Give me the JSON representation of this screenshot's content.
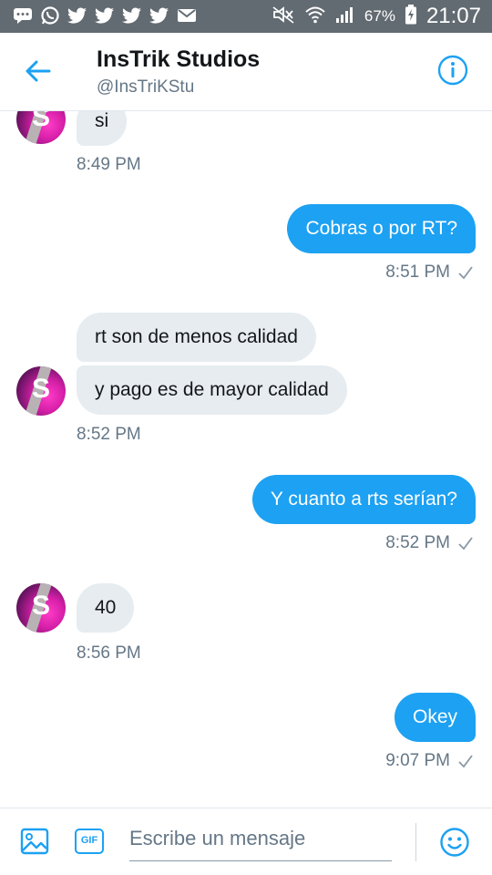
{
  "status_bar": {
    "battery_percent": "67%",
    "time": "21:07"
  },
  "header": {
    "title": "InsTrik Studios",
    "handle": "@InsTriKStu"
  },
  "avatar_letter": "S",
  "messages": [
    {
      "dir": "in",
      "text": "si"
    },
    {
      "dir": "time_in",
      "text": "8:49 PM"
    },
    {
      "dir": "out",
      "text": "Cobras o por RT?"
    },
    {
      "dir": "time_out",
      "text": "8:51 PM"
    },
    {
      "dir": "in",
      "text": "rt son de menos calidad"
    },
    {
      "dir": "in",
      "text": "y pago es de mayor calidad"
    },
    {
      "dir": "time_in",
      "text": "8:52 PM"
    },
    {
      "dir": "out",
      "text": "Y cuanto a rts serían?"
    },
    {
      "dir": "time_out",
      "text": "8:52 PM"
    },
    {
      "dir": "in",
      "text": "40"
    },
    {
      "dir": "time_in",
      "text": "8:56 PM"
    },
    {
      "dir": "out",
      "text": "Okey"
    },
    {
      "dir": "time_out",
      "text": "9:07 PM"
    }
  ],
  "composer": {
    "placeholder": "Escribe un mensaje",
    "gif_label": "GIF"
  },
  "colors": {
    "accent": "#1da1f2",
    "incoming_bubble": "#e6ecf0",
    "statusbar": "#636b72"
  }
}
